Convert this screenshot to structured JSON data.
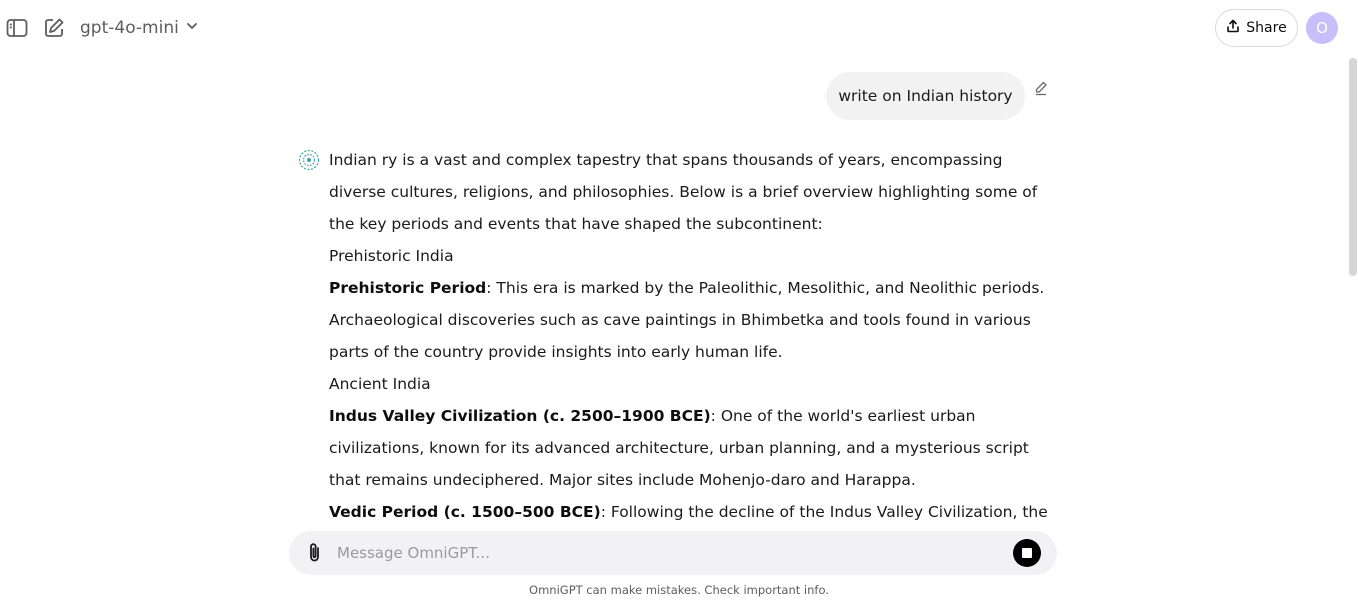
{
  "header": {
    "model_name": "gpt-4o-mini",
    "share_label": "Share",
    "avatar_initial": "O"
  },
  "conversation": {
    "user_message": "write on Indian history",
    "assistant_paragraphs": [
      {
        "bold": "",
        "text": "Indian ry is a vast and complex tapestry that spans thousands of years, encompassing diverse cultures, religions, and philosophies. Below is a brief overview highlighting some of the key periods and events that have shaped the subcontinent:"
      },
      {
        "bold": "",
        "text": "Prehistoric India"
      },
      {
        "bold": "Prehistoric Period",
        "text": ": This era is marked by the Paleolithic, Mesolithic, and Neolithic periods. Archaeological discoveries such as cave paintings in Bhimbetka and tools found in various parts of the country provide insights into early human life."
      },
      {
        "bold": "",
        "text": "Ancient India"
      },
      {
        "bold": "Indus Valley Civilization (c. 2500–1900 BCE)",
        "text": ": One of the world's earliest urban civilizations, known for its advanced architecture, urban planning, and a mysterious script that remains undeciphered. Major sites include Mohenjo-daro and Harappa."
      },
      {
        "bold": "Vedic Period (c. 1500–500 BCE)",
        "text": ": Following the decline of the Indus Valley Civilization, the Vedic"
      }
    ]
  },
  "composer": {
    "placeholder": "Message OmniGPT..."
  },
  "footer": {
    "disclaimer": "OmniGPT can make mistakes. Check important info."
  },
  "icons": {
    "sidebar_toggle": "sidebar-toggle-icon",
    "new_chat": "new-chat-icon",
    "chevron": "chevron-down-icon",
    "share": "share-upload-icon",
    "edit": "pencil-icon",
    "assistant": "openai-logo-icon",
    "attach": "paperclip-icon",
    "stop": "stop-icon"
  },
  "colors": {
    "avatar_bg": "#c8bffa",
    "bubble_bg": "#f2f2f2",
    "composer_bg": "#f2f2f4",
    "assistant_logo": "#3aa88f"
  }
}
